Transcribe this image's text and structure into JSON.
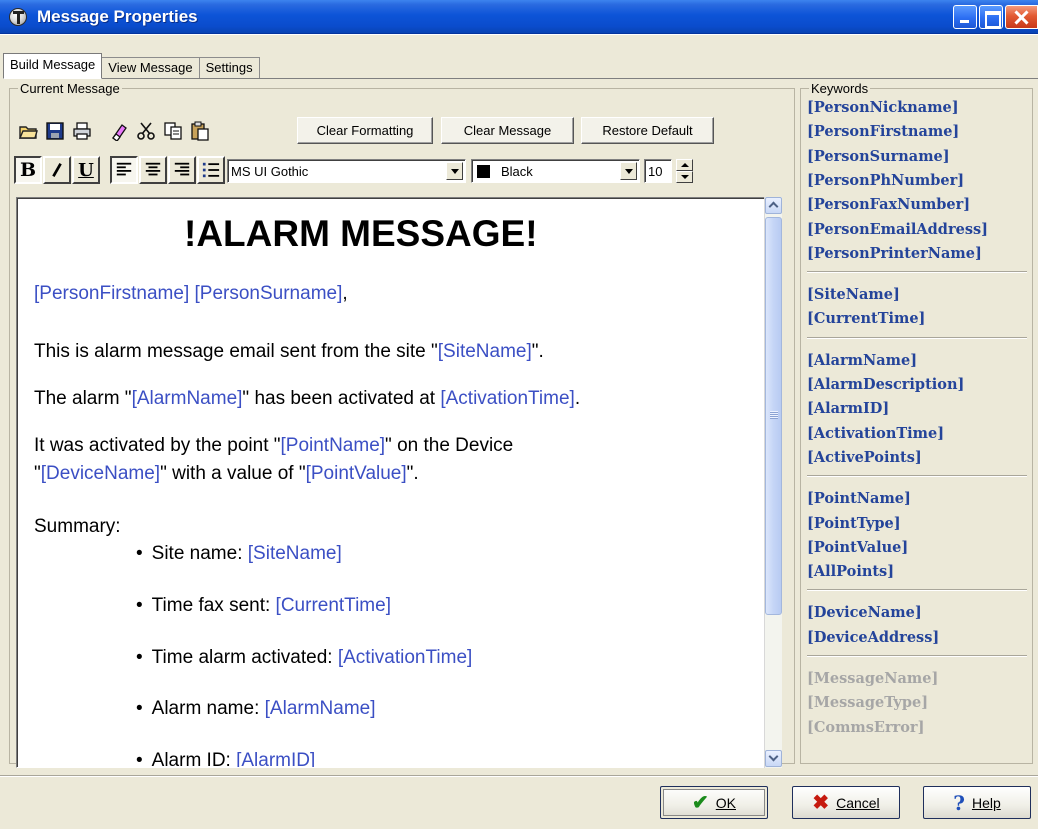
{
  "window": {
    "title": "Message Properties"
  },
  "tabs": [
    {
      "label": "Build Message",
      "active": true
    },
    {
      "label": "View Message",
      "active": false
    },
    {
      "label": "Settings",
      "active": false
    }
  ],
  "current_message": {
    "group_label": "Current Message",
    "toolbar": {
      "icons": [
        "open-folder-icon",
        "save-icon",
        "print-icon",
        "eraser-icon",
        "cut-icon",
        "copy-icon",
        "paste-icon"
      ],
      "clear_formatting": "Clear Formatting",
      "clear_message": "Clear Message",
      "restore_default": "Restore Default"
    },
    "format_bar": {
      "bold": "B",
      "italic": "I",
      "underline": "U",
      "font": "MS UI Gothic",
      "color_name": "Black",
      "color_swatch": "#000000",
      "size": "10"
    },
    "body": {
      "title": "!ALARM MESSAGE!",
      "greeting_kw1": "[PersonFirstname]",
      "greeting_kw2": "[PersonSurname]",
      "greeting_end": ",",
      "line1_a": "This is alarm message email sent from the site \"",
      "line1_kw": "[SiteName]",
      "line1_b": "\".",
      "line2_a": "The alarm \"",
      "line2_kw1": "[AlarmName]",
      "line2_b": "\" has been activated at ",
      "line2_kw2": "[ActivationTime]",
      "line2_c": ".",
      "line3_a": "It was activated by the point \"",
      "line3_kw1": "[PointName]",
      "line3_b": "\" on the Device",
      "line4_a": "\"",
      "line4_kw1": "[DeviceName]",
      "line4_b": "\" with a value of \"",
      "line4_kw2": "[PointValue]",
      "line4_c": "\".",
      "summary_label": "Summary:",
      "summary": [
        {
          "label": "Site name: ",
          "kw": "[SiteName]"
        },
        {
          "label": "Time fax sent: ",
          "kw": "[CurrentTime]"
        },
        {
          "label": "Time alarm activated: ",
          "kw": "[ActivationTime]"
        },
        {
          "label": "Alarm name: ",
          "kw": "[AlarmName]"
        },
        {
          "label": "Alarm ID: ",
          "kw": "[AlarmID]"
        }
      ]
    }
  },
  "keywords": {
    "group_label": "Keywords",
    "groups": [
      [
        "[PersonNickname]",
        "[PersonFirstname]",
        "[PersonSurname]",
        "[PersonPhNumber]",
        "[PersonFaxNumber]",
        "[PersonEmailAddress]",
        "[PersonPrinterName]"
      ],
      [
        "[SiteName]",
        "[CurrentTime]"
      ],
      [
        "[AlarmName]",
        "[AlarmDescription]",
        "[AlarmID]",
        "[ActivationTime]",
        "[ActivePoints]"
      ],
      [
        "[PointName]",
        "[PointType]",
        "[PointValue]",
        "[AllPoints]"
      ],
      [
        "[DeviceName]",
        "[DeviceAddress]"
      ],
      [
        "[MessageName]",
        "[MessageType]",
        "[CommsError]"
      ]
    ],
    "disabled_group_index": 5
  },
  "buttons": {
    "ok": "OK",
    "cancel": "Cancel",
    "help": "Help"
  }
}
